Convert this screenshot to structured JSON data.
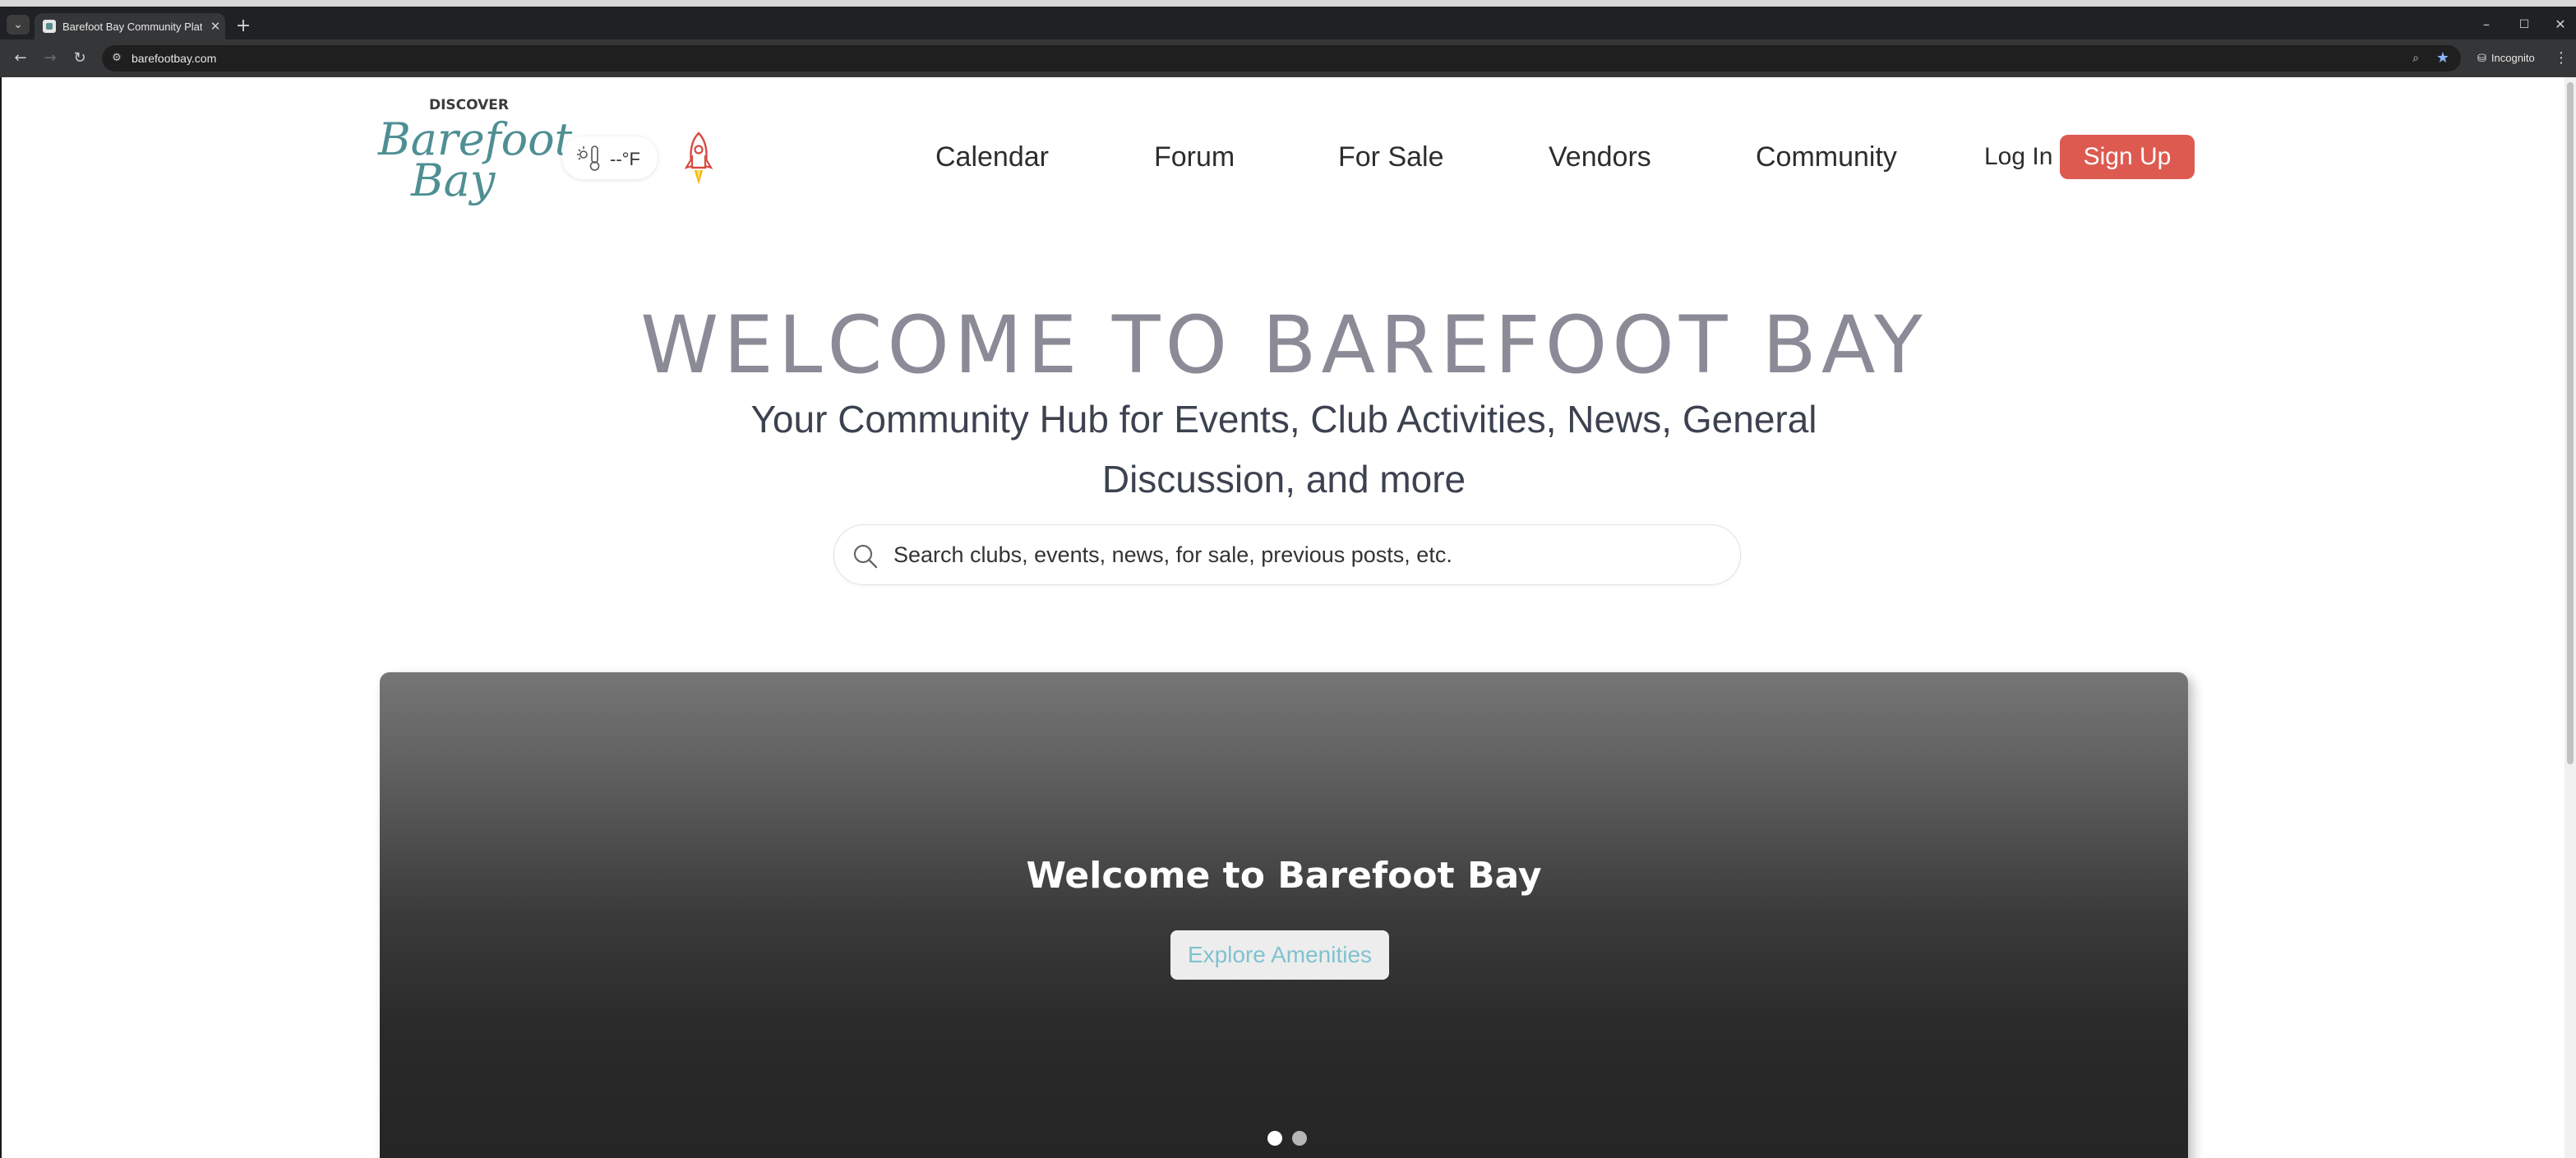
{
  "browser": {
    "tab_title": "Barefoot Bay Community Platfo",
    "new_tab_symbol": "+",
    "close_symbol": "✕",
    "url": "barefootbay.com",
    "incognito_label": "Incognito",
    "window_controls": {
      "minimize": "–",
      "maximize": "☐",
      "close": "✕"
    }
  },
  "header": {
    "logo": {
      "top": "DISCOVER",
      "line1": "Barefoot",
      "line2": "Bay"
    },
    "weather": {
      "temp": "--°F"
    },
    "nav": [
      {
        "label": "Calendar"
      },
      {
        "label": "Forum"
      },
      {
        "label": "For Sale"
      },
      {
        "label": "Vendors"
      },
      {
        "label": "Community"
      }
    ],
    "login_label": "Log In",
    "signup_label": "Sign Up"
  },
  "hero": {
    "title": "WELCOME TO BAREFOOT BAY",
    "subtitle": "Your Community Hub for Events, Club Activities, News, General Discussion, and more",
    "search_placeholder": "Search clubs, events, news, for sale, previous posts, etc."
  },
  "carousel": {
    "slide_title": "Welcome to Barefoot Bay",
    "button_label": "Explore Amenities",
    "active_slide": 1,
    "slide_count": 2
  },
  "colors": {
    "accent_red": "#dd5a50",
    "logo_teal": "#4f8f93",
    "button_text_teal": "#7fc3cf",
    "title_gray": "#8b8b98"
  }
}
